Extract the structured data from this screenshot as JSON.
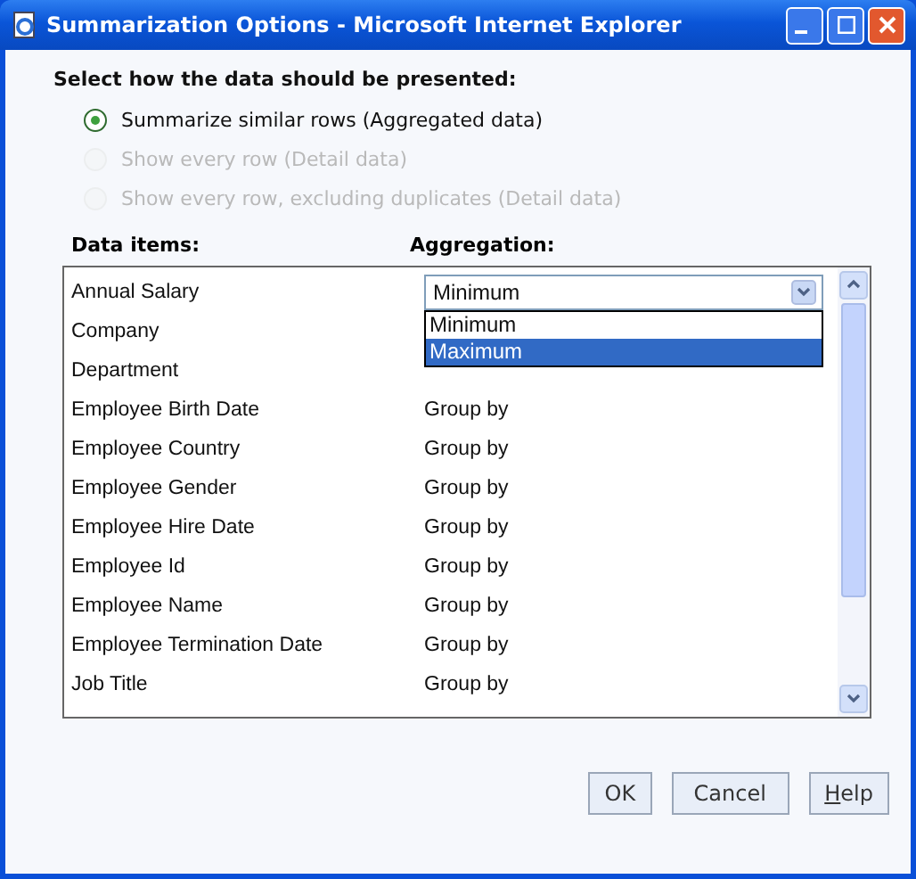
{
  "window": {
    "title": "Summarization Options - Microsoft Internet Explorer"
  },
  "heading": "Select how the data should be presented:",
  "options": [
    {
      "label": "Summarize similar rows (Aggregated data)",
      "selected": true,
      "disabled": false
    },
    {
      "label": "Show every row (Detail data)",
      "selected": false,
      "disabled": true
    },
    {
      "label": "Show every row, excluding duplicates (Detail data)",
      "selected": false,
      "disabled": true
    }
  ],
  "columns": [
    "Data items:",
    "Aggregation:"
  ],
  "rows": [
    {
      "item": "Annual Salary",
      "kind": "select",
      "aggregation": "Minimum",
      "expanded": true,
      "choices": [
        {
          "label": "Minimum",
          "selected": false
        },
        {
          "label": "Maximum",
          "selected": true
        }
      ]
    },
    {
      "item": "Company",
      "kind": "text"
    },
    {
      "item": "Department",
      "kind": "text"
    },
    {
      "item": "Employee Birth Date",
      "kind": "text",
      "aggregation": "Group by"
    },
    {
      "item": "Employee Country",
      "kind": "text",
      "aggregation": "Group by"
    },
    {
      "item": "Employee Gender",
      "kind": "text",
      "aggregation": "Group by"
    },
    {
      "item": "Employee Hire Date",
      "kind": "text",
      "aggregation": "Group by"
    },
    {
      "item": "Employee Id",
      "kind": "text",
      "aggregation": "Group by"
    },
    {
      "item": "Employee Name",
      "kind": "text",
      "aggregation": "Group by"
    },
    {
      "item": "Employee Termination Date",
      "kind": "text",
      "aggregation": "Group by"
    },
    {
      "item": "Job Title",
      "kind": "text",
      "aggregation": "Group by"
    }
  ],
  "buttons": [
    {
      "label": "OK",
      "mnemonic": false
    },
    {
      "label": "Cancel",
      "mnemonic": false
    },
    {
      "label": "Help",
      "mnemonic": true
    }
  ]
}
